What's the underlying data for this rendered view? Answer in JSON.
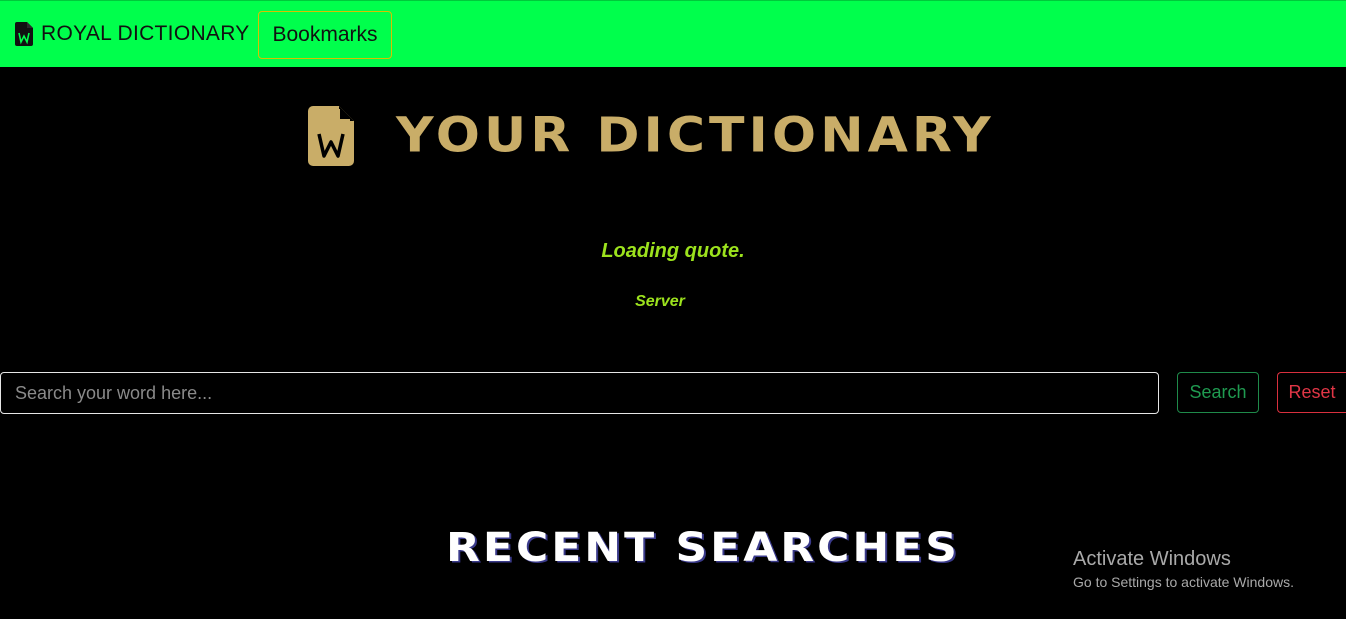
{
  "navbar": {
    "brand_icon": "word-file-icon",
    "brand_label": "ROYAL DICTIONARY",
    "bookmarks_label": "Bookmarks",
    "background": "#00ff4c"
  },
  "hero": {
    "icon": "word-file-icon",
    "title": "YOUR DICTIONARY",
    "color": "#c9ad68"
  },
  "quote": {
    "text": "Loading quote.",
    "author": "Server",
    "color": "#9ce21d"
  },
  "search": {
    "placeholder": "Search your word here...",
    "value": "",
    "search_label": "Search",
    "reset_label": "Reset"
  },
  "recent": {
    "title": "RECENT SEARCHES"
  },
  "os_overlay": {
    "title": "Activate Windows",
    "subtitle": "Go to Settings to activate Windows."
  }
}
